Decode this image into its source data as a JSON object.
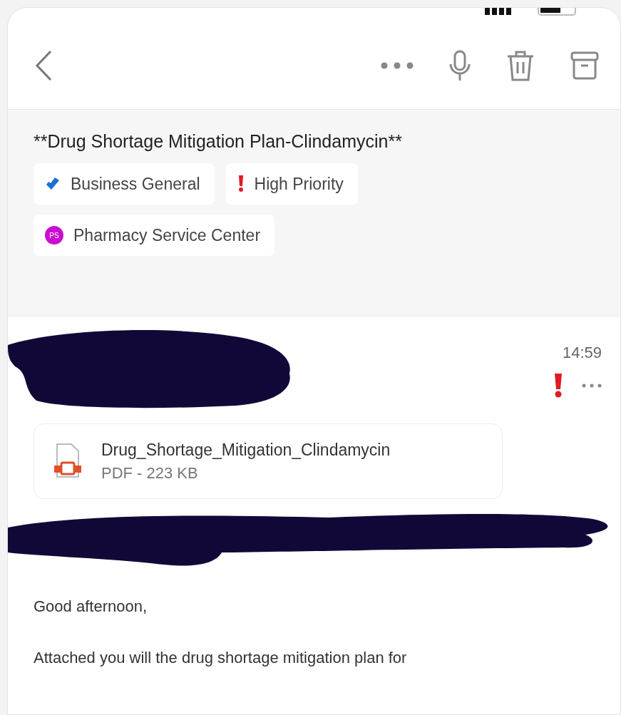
{
  "subject": "**Drug Shortage Mitigation Plan-Clindamycin**",
  "tags": [
    {
      "kind": "category",
      "label": "Business General"
    },
    {
      "kind": "priority",
      "label": "High Priority"
    },
    {
      "kind": "group",
      "label": "Pharmacy Service Center",
      "initials": "PS"
    }
  ],
  "message": {
    "time": "14:59",
    "high_priority": true,
    "attachment": {
      "name": "Drug_Shortage_Mitigation_Clindamycin",
      "meta": "PDF - 223 KB"
    },
    "body": [
      "Good afternoon,",
      "Attached you will the drug shortage mitigation plan for"
    ]
  }
}
